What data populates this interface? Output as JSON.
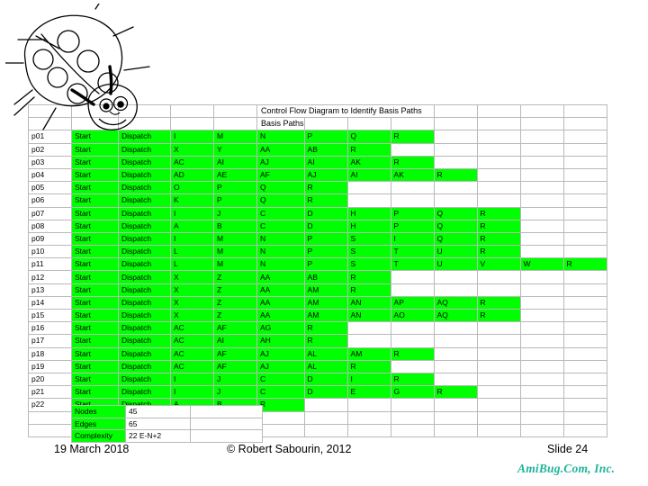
{
  "slide": {
    "titles": {
      "control_flow": "Control Flow Diagram to Identify Basis Paths",
      "basis_paths": "Basis Paths"
    }
  },
  "table": {
    "highlight_color": "#00ff00",
    "grid_color": "#b9b9b9",
    "rows": [
      {
        "id": "p01",
        "cells": [
          "Start",
          "Dispatch",
          "I",
          "M",
          "N",
          "P",
          "Q",
          "R"
        ]
      },
      {
        "id": "p02",
        "cells": [
          "Start",
          "Dispatch",
          "X",
          "Y",
          "AA",
          "AB",
          "R"
        ]
      },
      {
        "id": "p03",
        "cells": [
          "Start",
          "Dispatch",
          "AC",
          "AI",
          "AJ",
          "AI",
          "AK",
          "R"
        ]
      },
      {
        "id": "p04",
        "cells": [
          "Start",
          "Dispatch",
          "AD",
          "AE",
          "AF",
          "AJ",
          "AI",
          "AK",
          "R"
        ]
      },
      {
        "id": "p05",
        "cells": [
          "Start",
          "Dispatch",
          "O",
          "P",
          "Q",
          "R"
        ]
      },
      {
        "id": "p06",
        "cells": [
          "Start",
          "Dispatch",
          "K",
          "P",
          "Q",
          "R"
        ]
      },
      {
        "id": "p07",
        "cells": [
          "Start",
          "Dispatch",
          "I",
          "J",
          "C",
          "D",
          "H",
          "P",
          "Q",
          "R"
        ]
      },
      {
        "id": "p08",
        "cells": [
          "Start",
          "Dispatch",
          "A",
          "B",
          "C",
          "D",
          "H",
          "P",
          "Q",
          "R"
        ]
      },
      {
        "id": "p09",
        "cells": [
          "Start",
          "Dispatch",
          "I",
          "M",
          "N",
          "P",
          "S",
          "I",
          "Q",
          "R"
        ]
      },
      {
        "id": "p10",
        "cells": [
          "Start",
          "Dispatch",
          "L",
          "M",
          "N",
          "P",
          "S",
          "T",
          "U",
          "R"
        ]
      },
      {
        "id": "p11",
        "cells": [
          "Start",
          "Dispatch",
          "L",
          "M",
          "N",
          "P",
          "S",
          "T",
          "U",
          "V",
          "W",
          "R"
        ]
      },
      {
        "id": "p12",
        "cells": [
          "Start",
          "Dispatch",
          "X",
          "Z",
          "AA",
          "AB",
          "R"
        ]
      },
      {
        "id": "p13",
        "cells": [
          "Start",
          "Dispatch",
          "X",
          "Z",
          "AA",
          "AM",
          "R"
        ]
      },
      {
        "id": "p14",
        "cells": [
          "Start",
          "Dispatch",
          "X",
          "Z",
          "AA",
          "AM",
          "AN",
          "AP",
          "AQ",
          "R"
        ]
      },
      {
        "id": "p15",
        "cells": [
          "Start",
          "Dispatch",
          "X",
          "Z",
          "AA",
          "AM",
          "AN",
          "AO",
          "AQ",
          "R"
        ]
      },
      {
        "id": "p16",
        "cells": [
          "Start",
          "Dispatch",
          "AC",
          "AF",
          "AG",
          "R"
        ]
      },
      {
        "id": "p17",
        "cells": [
          "Start",
          "Dispatch",
          "AC",
          "AI",
          "AH",
          "R"
        ]
      },
      {
        "id": "p18",
        "cells": [
          "Start",
          "Dispatch",
          "AC",
          "AF",
          "AJ",
          "AL",
          "AM",
          "R"
        ]
      },
      {
        "id": "p19",
        "cells": [
          "Start",
          "Dispatch",
          "AC",
          "AF",
          "AJ",
          "AL",
          "R"
        ]
      },
      {
        "id": "p20",
        "cells": [
          "Start",
          "Dispatch",
          "I",
          "J",
          "C",
          "D",
          "I",
          "R"
        ]
      },
      {
        "id": "p21",
        "cells": [
          "Start",
          "Dispatch",
          "I",
          "J",
          "C",
          "D",
          "E",
          "G",
          "R"
        ]
      },
      {
        "id": "p22",
        "cells": [
          "Start",
          "Dispatch",
          "A",
          "B",
          "R"
        ]
      }
    ]
  },
  "summary": {
    "rows": [
      {
        "label": "Nodes",
        "value": "45"
      },
      {
        "label": "Edges",
        "value": "65"
      },
      {
        "label": "Complexity",
        "value": "22 E-N+2"
      }
    ]
  },
  "footer": {
    "date": "19 March 2018",
    "copyright": "© Robert Sabourin, 2012",
    "slide_number": "Slide 24",
    "brand": "AmiBug.Com, Inc.",
    "brand_color": "#1fb39b"
  }
}
